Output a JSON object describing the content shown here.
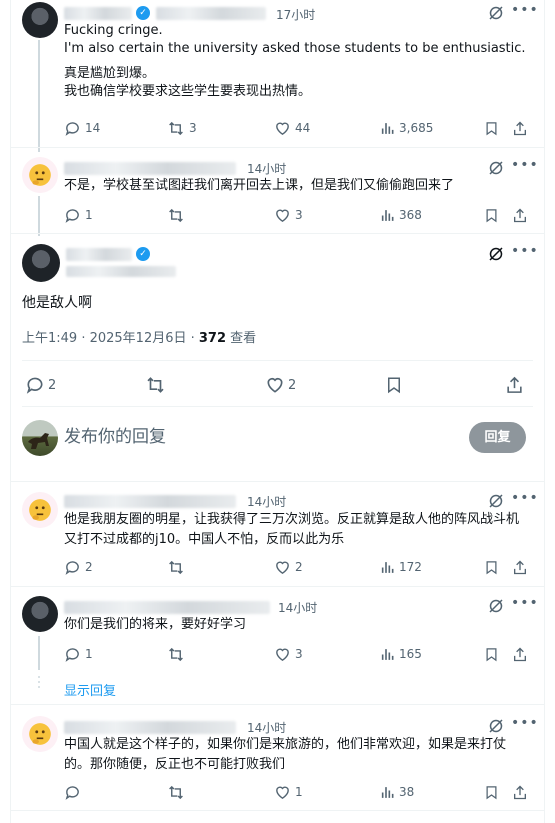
{
  "tweet1": {
    "time": "17小时",
    "line1": "Fucking cringe.",
    "line2": "I'm also certain the university asked those students to be enthusiastic.",
    "line3": "真是尴尬到爆。",
    "line4": "我也确信学校要求这些学生要表现出热情。",
    "replies": "14",
    "reposts": "3",
    "likes": "44",
    "views": "3,685"
  },
  "tweet2": {
    "time": "14小时",
    "text": "不是，学校甚至试图赶我们离开回去上课，但是我们又偷偷跑回来了",
    "replies": "1",
    "reposts": "",
    "likes": "3",
    "views": "368"
  },
  "main": {
    "text": "他是敌人啊",
    "timestamp": "上午1:49 · 2025年12月6日 · ",
    "views_count": "372",
    "views_label": " 查看",
    "replies": "2",
    "likes": "2"
  },
  "compose": {
    "placeholder": "发布你的回复",
    "button": "回复"
  },
  "reply1": {
    "time": "14小时",
    "text": "他是我朋友圈的明星，让我获得了三万次浏览。反正就算是敌人他的阵风战斗机又打不过成都的j10。中国人不怕，反而以此为乐",
    "replies": "2",
    "likes": "2",
    "views": "172"
  },
  "reply2": {
    "time": "14小时",
    "text": "你们是我们的将来，要好好学习",
    "replies": "1",
    "likes": "3",
    "views": "165"
  },
  "show_replies": "显示回复",
  "reply3": {
    "time": "14小时",
    "text": "中国人就是这个样子的，如果你们是来旅游的，他们非常欢迎，如果是来打仗的。那你随便，反正也不可能打败我们",
    "replies": "",
    "likes": "1",
    "views": "38"
  },
  "colors": {
    "accent": "#1d9bf0",
    "muted": "#536471",
    "button": "#8e969c"
  }
}
